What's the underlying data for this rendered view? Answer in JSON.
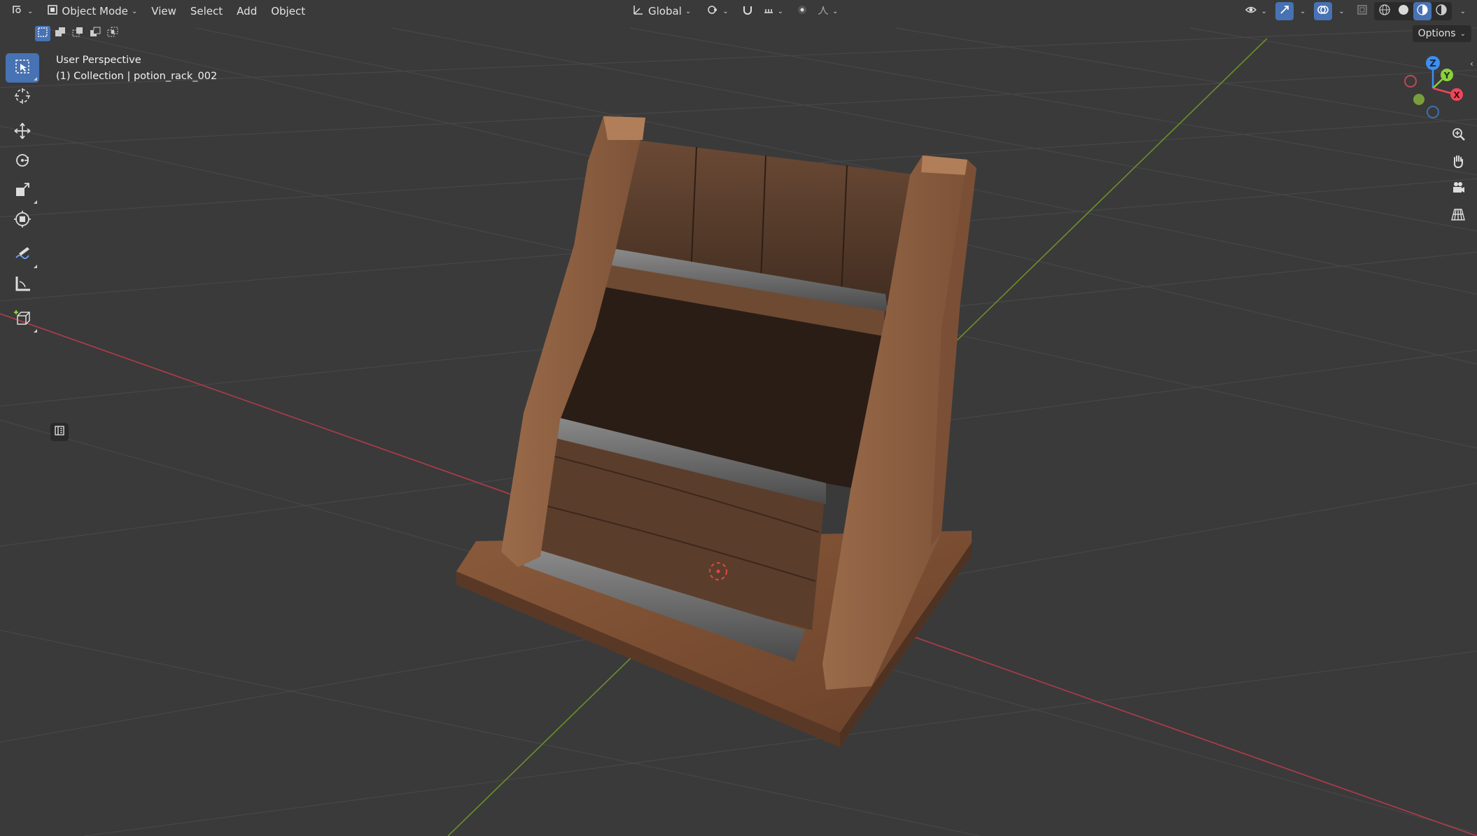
{
  "header": {
    "mode_label": "Object Mode",
    "menus": [
      "View",
      "Select",
      "Add",
      "Object"
    ],
    "transform_orientation": "Global"
  },
  "options_label": "Options",
  "overlay": {
    "view_name": "User Perspective",
    "collection_info": "(1) Collection | potion_rack_002"
  },
  "gizmo": {
    "z_label": "Z",
    "y_label": "Y",
    "x_label": "X"
  },
  "colors": {
    "accent": "#4772b3",
    "viewport_bg": "#3a3a3a",
    "grid": "#474747",
    "x_axis": "#b13c4a",
    "y_axis": "#6d8f2a",
    "gizmo_x": "#f0465a",
    "gizmo_y": "#8bd13b",
    "gizmo_z": "#3f8ef0"
  },
  "toolbar_icons": [
    "select-box-icon",
    "cursor-icon",
    "move-icon",
    "rotate-icon",
    "scale-icon",
    "transform-icon",
    "annotate-icon",
    "measure-icon",
    "add-cube-icon"
  ]
}
